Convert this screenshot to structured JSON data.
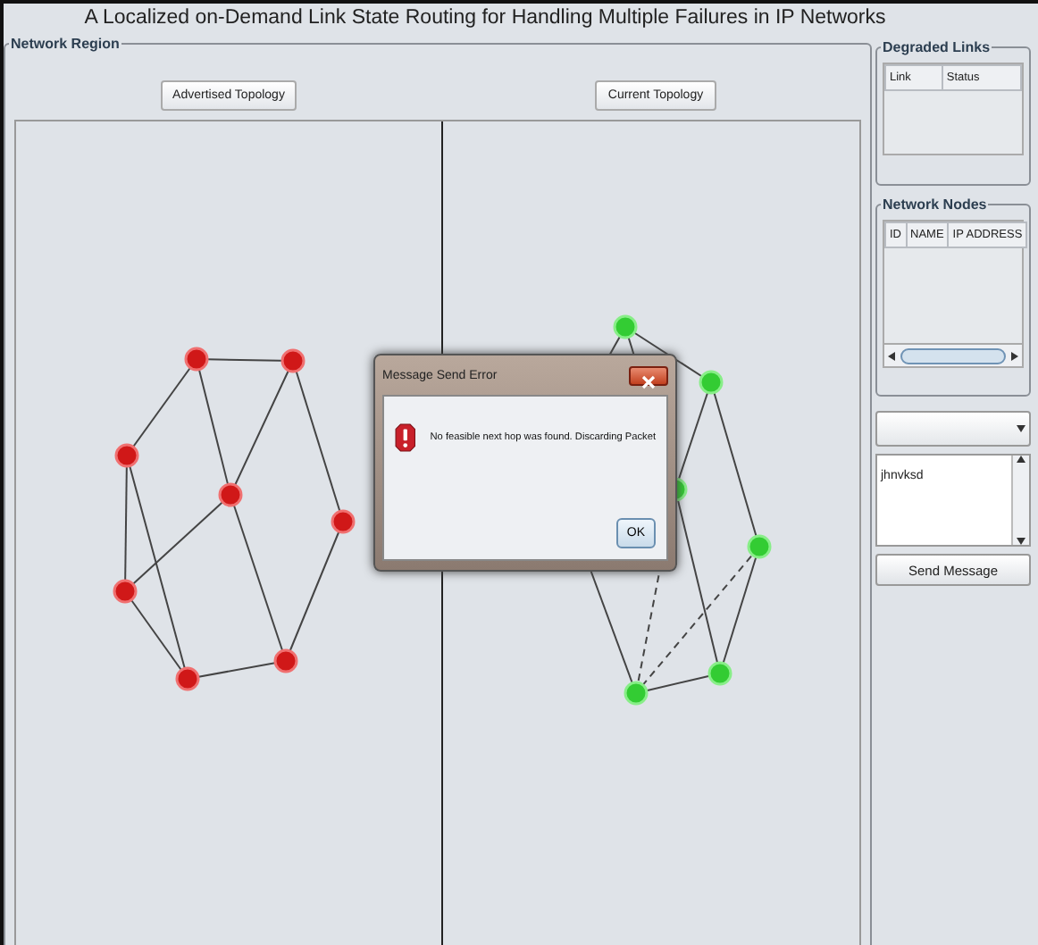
{
  "title": "A Localized on-Demand Link State Routing for  Handling Multiple Failures in IP Networks",
  "network_region": {
    "label": "Network Region",
    "buttons": [
      "Advertised Topology",
      "Current Topology"
    ]
  },
  "degraded_links": {
    "label": "Degraded Links",
    "columns": [
      "Link",
      "Status"
    ]
  },
  "network_nodes": {
    "label": "Network Nodes",
    "columns": [
      "ID",
      "NAME",
      "IP ADDRESS"
    ]
  },
  "message": {
    "value": "jhnvksd"
  },
  "send_button": "Send Message",
  "dialog": {
    "title": "Message Send Error",
    "message": "No feasible next hop was found. Discarding Packet",
    "button": "OK"
  }
}
